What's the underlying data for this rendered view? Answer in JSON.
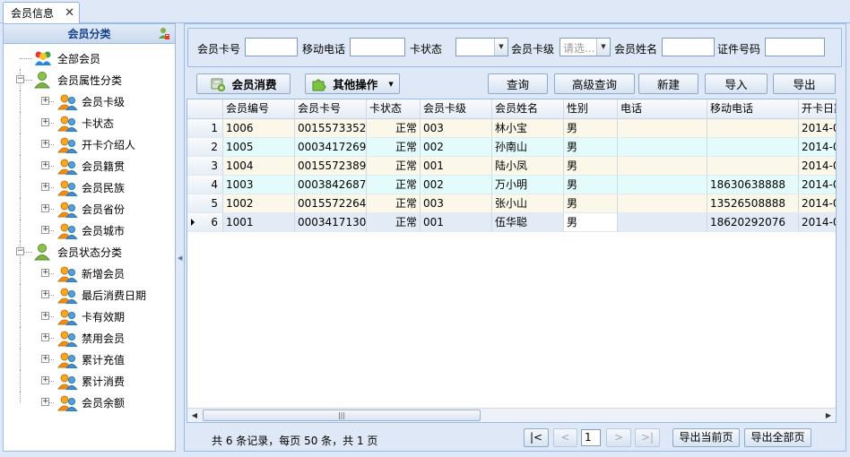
{
  "tab": {
    "title": "会员信息",
    "close": "✕"
  },
  "left": {
    "title": "会员分类",
    "tree": [
      {
        "label": "全部会员",
        "level": 0,
        "icon": "all-members-icon",
        "expander": ""
      },
      {
        "label": "会员属性分类",
        "level": 0,
        "icon": "member-group-icon",
        "expander": "−"
      },
      {
        "label": "会员卡级",
        "level": 1,
        "icon": "members-icon",
        "expander": "+"
      },
      {
        "label": "卡状态",
        "level": 1,
        "icon": "members-icon",
        "expander": "+"
      },
      {
        "label": "开卡介绍人",
        "level": 1,
        "icon": "members-icon",
        "expander": "+"
      },
      {
        "label": "会员籍贯",
        "level": 1,
        "icon": "members-icon",
        "expander": "+"
      },
      {
        "label": "会员民族",
        "level": 1,
        "icon": "members-icon",
        "expander": "+"
      },
      {
        "label": "会员省份",
        "level": 1,
        "icon": "members-icon",
        "expander": "+"
      },
      {
        "label": "会员城市",
        "level": 1,
        "icon": "members-icon",
        "expander": "+"
      },
      {
        "label": "会员状态分类",
        "level": 0,
        "icon": "member-group-icon",
        "expander": "−"
      },
      {
        "label": "新增会员",
        "level": 1,
        "icon": "members-icon",
        "expander": "+"
      },
      {
        "label": "最后消费日期",
        "level": 1,
        "icon": "members-icon",
        "expander": "+"
      },
      {
        "label": "卡有效期",
        "level": 1,
        "icon": "members-icon",
        "expander": "+"
      },
      {
        "label": "禁用会员",
        "level": 1,
        "icon": "members-icon",
        "expander": "+"
      },
      {
        "label": "累计充值",
        "level": 1,
        "icon": "members-icon",
        "expander": "+"
      },
      {
        "label": "累计消费",
        "level": 1,
        "icon": "members-icon",
        "expander": "+"
      },
      {
        "label": "会员余额",
        "level": 1,
        "icon": "members-icon",
        "expander": "+"
      }
    ]
  },
  "search": {
    "card_no_label": "会员卡号",
    "mobile_label": "移动电话",
    "status_label": "卡状态",
    "level_label": "会员卡级",
    "level_placeholder": "请选...",
    "name_label": "会员姓名",
    "id_label": "证件号码"
  },
  "toolbar": {
    "consume": "会员消费",
    "other": "其他操作",
    "query": "查询",
    "advanced": "高级查询",
    "new": "新建",
    "import": "导入",
    "export": "导出"
  },
  "grid": {
    "columns": [
      "",
      "会员编号",
      "会员卡号",
      "卡状态",
      "会员卡级",
      "会员姓名",
      "性别",
      "电话",
      "移动电话",
      "开卡日期"
    ],
    "rows": [
      [
        "1",
        "1006",
        "0015573352",
        "正常",
        "003",
        "林小宝",
        "男",
        "",
        "",
        "2014-0"
      ],
      [
        "2",
        "1005",
        "0003417269",
        "正常",
        "002",
        "孙南山",
        "男",
        "",
        "",
        "2014-0"
      ],
      [
        "3",
        "1004",
        "0015572389",
        "正常",
        "001",
        "陆小凤",
        "男",
        "",
        "",
        "2014-0"
      ],
      [
        "4",
        "1003",
        "0003842687",
        "正常",
        "002",
        "万小明",
        "男",
        "",
        "18630638888",
        "2014-0"
      ],
      [
        "5",
        "1002",
        "0015572264",
        "正常",
        "003",
        "张小山",
        "男",
        "",
        "13526508888",
        "2014-0"
      ],
      [
        "6",
        "1001",
        "0003417130",
        "正常",
        "001",
        "伍华聪",
        "男",
        "",
        "18620292076",
        "2014-0"
      ]
    ],
    "current_row": 5
  },
  "pager": {
    "info": "共 6 条记录，每页 50 条，共 1 页",
    "first": "|<",
    "prev": "<",
    "page": "1",
    "next": ">",
    "last": ">|",
    "export_current": "导出当前页",
    "export_all": "导出全部页"
  }
}
